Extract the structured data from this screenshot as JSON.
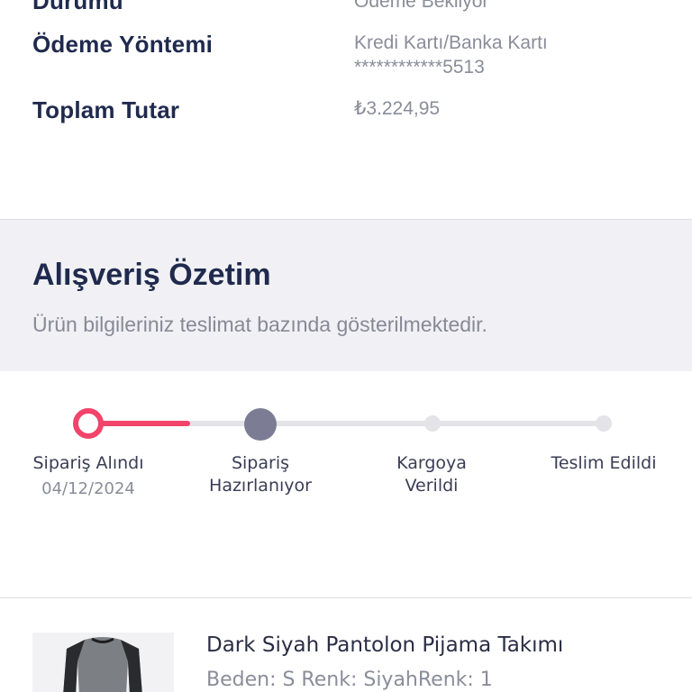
{
  "order_info": {
    "status_label": "Durumu",
    "status_value": "Ödeme Bekliyor",
    "payment_label": "Ödeme Yöntemi",
    "payment_value_line1": "Kredi Kartı/Banka Kartı",
    "payment_value_line2": "************5513",
    "total_label": "Toplam Tutar",
    "total_value": "₺3.224,95"
  },
  "summary": {
    "title": "Alışveriş Özetim",
    "subtitle": "Ürün bilgileriniz teslimat bazında gösterilmektedir."
  },
  "tracking": {
    "progress_fraction": 0.2,
    "steps": [
      {
        "line1": "Sipariş Alındı",
        "line2": "",
        "date": "04/12/2024",
        "state": "completed"
      },
      {
        "line1": "Sipariş",
        "line2": "Hazırlanıyor",
        "date": "",
        "state": "current"
      },
      {
        "line1": "Kargoya",
        "line2": "Verildi",
        "date": "",
        "state": "pending"
      },
      {
        "line1": "Teslim Edildi",
        "line2": "",
        "date": "",
        "state": "pending"
      }
    ]
  },
  "product": {
    "name": "Dark Siyah Pantolon Pijama Takımı",
    "meta": "Beden: S Renk: SiyahRenk: 1",
    "image_icon": "sweatshirt-icon"
  },
  "colors": {
    "accent": "#f2436a",
    "heading": "#1f2a4d",
    "muted": "#8a8d99",
    "current_step": "#7c7d95",
    "panel_bg": "#f1f1f5"
  }
}
